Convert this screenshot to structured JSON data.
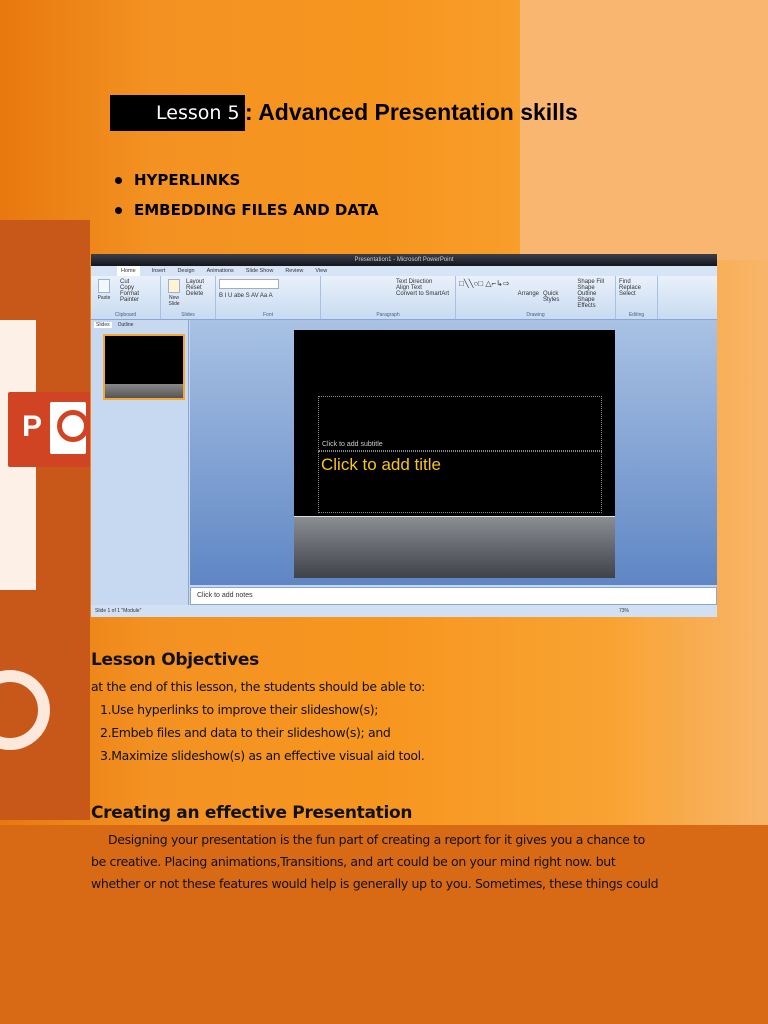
{
  "header": {
    "lesson": "Lesson 5",
    "title": ": Advanced Presentation skills"
  },
  "bullets": [
    "HYPERLINKS",
    "EMBEDDING FILES AND DATA"
  ],
  "screenshot": {
    "window_title": "Presentation1 - Microsoft PowerPoint",
    "tabs": [
      "Home",
      "Insert",
      "Design",
      "Animations",
      "Slide Show",
      "Review",
      "View"
    ],
    "groups": [
      {
        "label": "Clipboard",
        "items": [
          "Paste",
          "Cut",
          "Copy",
          "Format Painter"
        ]
      },
      {
        "label": "Slides",
        "items": [
          "New Slide",
          "Layout",
          "Reset",
          "Delete"
        ]
      },
      {
        "label": "Font",
        "items": [
          "B I U abe S AV Aa A"
        ]
      },
      {
        "label": "Paragraph",
        "items": [
          "Text Direction",
          "Align Text",
          "Convert to SmartArt"
        ]
      },
      {
        "label": "Drawing",
        "items": [
          "Arrange",
          "Quick Styles",
          "Shape Fill",
          "Shape Outline",
          "Shape Effects"
        ]
      },
      {
        "label": "Editing",
        "items": [
          "Find",
          "Replace",
          "Select"
        ]
      }
    ],
    "pane_tabs": [
      "Slides",
      "Outline"
    ],
    "slide_title": "Click to add title",
    "slide_subtitle": "Click to add subtitle",
    "notes": "Click to add notes",
    "status_left": "Slide 1 of 1   \"Module\"",
    "zoom": "73%"
  },
  "objectives": {
    "heading": "Lesson Objectives",
    "intro": "at the end of this lesson, the students should be able to:",
    "items": [
      "1.Use hyperlinks to improve their slideshow(s);",
      "2.Embeb files and data to their slideshow(s); and",
      "3.Maximize slideshow(s)  as an effective visual aid tool."
    ]
  },
  "creating": {
    "heading": "Creating an effective Presentation",
    "lines": [
      "Designing your presentation is the fun part of creating a report for it gives you a chance to",
      "be creative. Placing animations,Transitions, and art could be on your mind right now. but",
      "whether or not these features would help is generally up to you. Sometimes, these things could"
    ]
  }
}
